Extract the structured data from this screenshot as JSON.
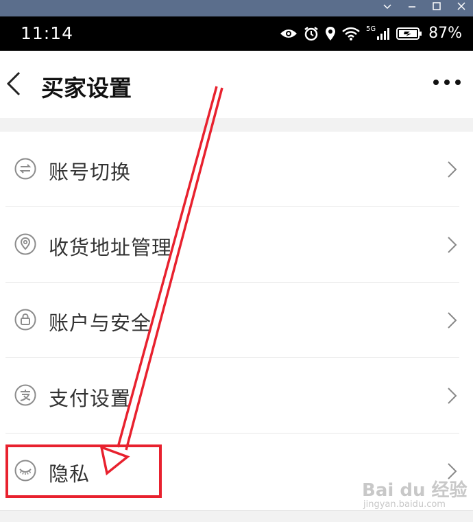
{
  "status_bar": {
    "time": "11:14",
    "network": "5G",
    "battery": "87%"
  },
  "header": {
    "title": "买家设置"
  },
  "settings": {
    "items": [
      {
        "label": "账号切换",
        "icon": "switch-icon"
      },
      {
        "label": "收货地址管理",
        "icon": "location-icon"
      },
      {
        "label": "账户与安全",
        "icon": "lock-icon"
      },
      {
        "label": "支付设置",
        "icon": "pay-icon"
      },
      {
        "label": "隐私",
        "icon": "eye-closed-icon"
      }
    ]
  },
  "watermark": {
    "brand": "Bai du 经验",
    "url": "jingyan.baidu.com"
  },
  "colors": {
    "annotation": "#e8212e",
    "window_bar": "#5b6e8c"
  }
}
